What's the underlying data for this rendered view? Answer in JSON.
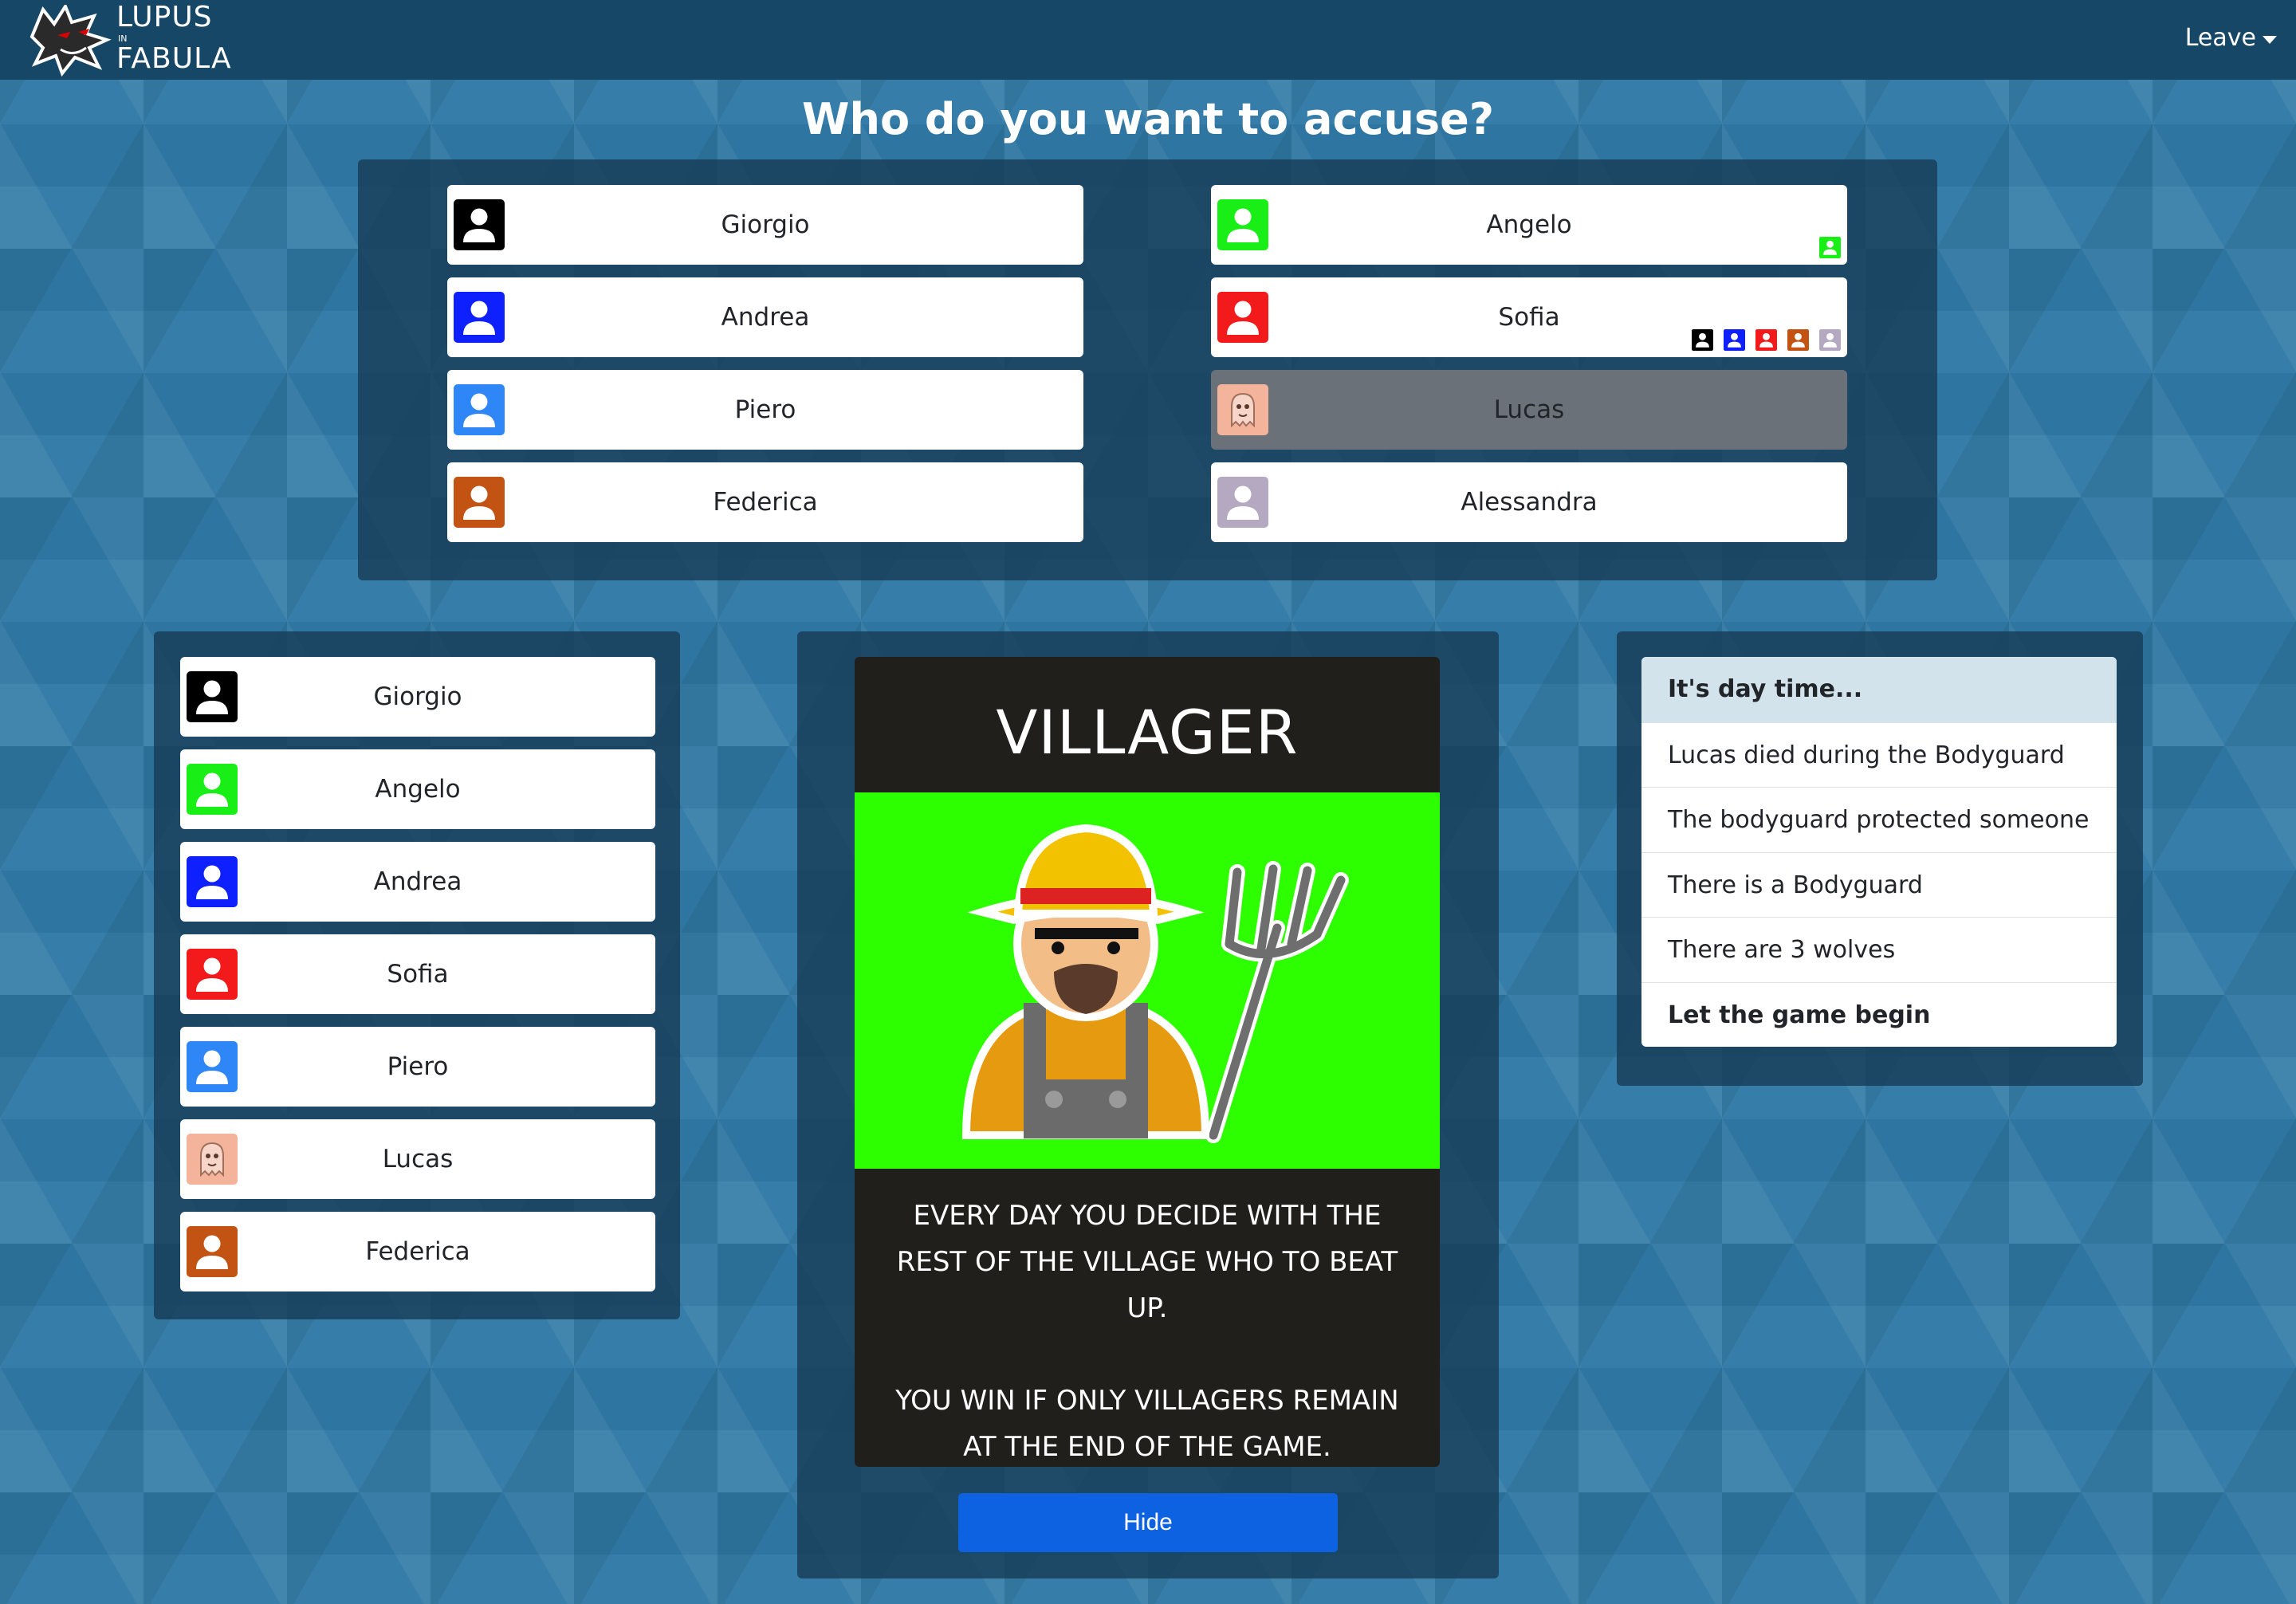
{
  "app": {
    "brand_top": "LUPUS",
    "brand_mid": "IN",
    "brand_bottom": "FABULA",
    "leave_label": "Leave"
  },
  "heading": "Who do you want to accuse?",
  "accuse": {
    "left": [
      {
        "name": "Giorgio",
        "color": "#000000",
        "avatar": "person-icon",
        "state": "alive"
      },
      {
        "name": "Andrea",
        "color": "#0f20ff",
        "avatar": "person-icon",
        "state": "alive"
      },
      {
        "name": "Piero",
        "color": "#2f86f6",
        "avatar": "person-icon",
        "state": "alive"
      },
      {
        "name": "Federica",
        "color": "#c35312",
        "avatar": "person-icon",
        "state": "alive"
      }
    ],
    "right": [
      {
        "name": "Angelo",
        "color": "#19ef17",
        "avatar": "person-icon",
        "state": "alive",
        "votes": [
          "#19ef17"
        ]
      },
      {
        "name": "Sofia",
        "color": "#f21a1a",
        "avatar": "person-icon",
        "state": "alive",
        "votes": [
          "#000000",
          "#0f20ff",
          "#f21a1a",
          "#c35312",
          "#b4a9c1"
        ]
      },
      {
        "name": "Lucas",
        "color": "#f3b49b",
        "avatar": "ghost-icon",
        "state": "dead"
      },
      {
        "name": "Alessandra",
        "color": "#b4a9c1",
        "avatar": "person-icon",
        "state": "alive"
      }
    ]
  },
  "players": [
    {
      "name": "Giorgio",
      "color": "#000000",
      "avatar": "person-icon"
    },
    {
      "name": "Angelo",
      "color": "#19ef17",
      "avatar": "person-icon"
    },
    {
      "name": "Andrea",
      "color": "#0f20ff",
      "avatar": "person-icon"
    },
    {
      "name": "Sofia",
      "color": "#f21a1a",
      "avatar": "person-icon"
    },
    {
      "name": "Piero",
      "color": "#2f86f6",
      "avatar": "person-icon"
    },
    {
      "name": "Lucas",
      "color": "#f3b49b",
      "avatar": "ghost-icon"
    },
    {
      "name": "Federica",
      "color": "#c35312",
      "avatar": "person-icon"
    }
  ],
  "role_card": {
    "title": "VILLAGER",
    "description_1": "EVERY DAY YOU DECIDE WITH THE REST OF THE VILLAGE WHO TO BEAT UP.",
    "description_2": "YOU WIN IF ONLY VILLAGERS REMAIN AT THE END OF THE GAME.",
    "background_color": "#2eff00",
    "hide_label": "Hide"
  },
  "events": [
    "It's day time...",
    "Lucas died during the Bodyguard",
    "The bodyguard protected someone",
    "There is a Bodyguard",
    "There are 3 wolves",
    "Let the game begin"
  ]
}
